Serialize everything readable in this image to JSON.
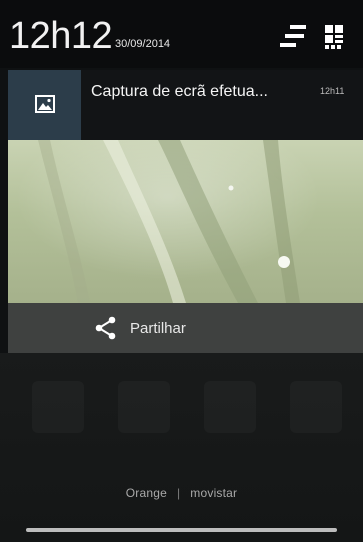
{
  "header": {
    "time": "12h12",
    "date": "30/09/2014",
    "settings_icon": "quick-settings-icon",
    "toggles_icon": "toggles-grid-icon"
  },
  "notification": {
    "title": "Captura de ecrã efetua...",
    "time": "12h11",
    "icon": "image-icon"
  },
  "share": {
    "label": "Partilhar",
    "icon": "share-icon"
  },
  "carrier": {
    "left": "Orange",
    "separator": "|",
    "right": "movistar"
  },
  "colors": {
    "icon_box": "#2c3d4a",
    "share_bar": "#3f4140",
    "header_bg": "#0b0c0d"
  }
}
